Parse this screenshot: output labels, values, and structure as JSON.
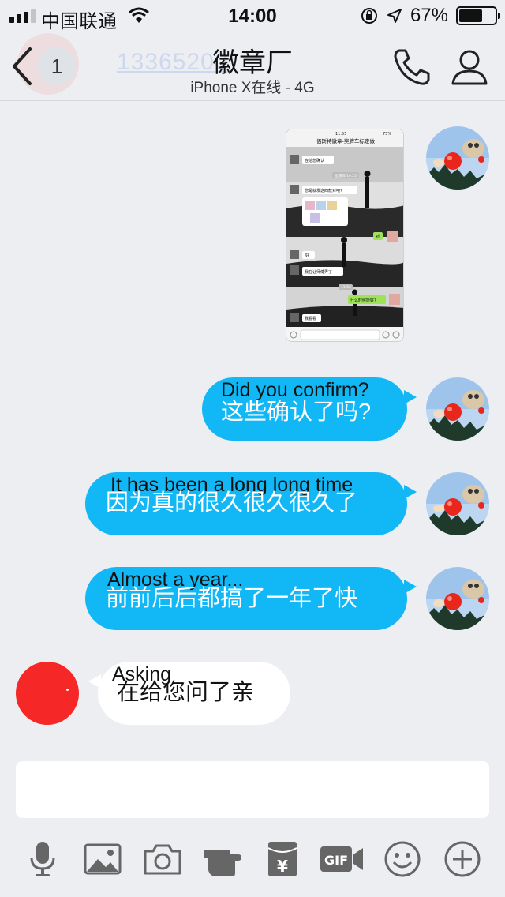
{
  "status_bar": {
    "carrier": "中国联通",
    "time": "14:00",
    "battery_text": "67%",
    "battery_level": 0.67
  },
  "nav": {
    "unread_count": "1",
    "ghost_number": "13365200",
    "title": "徽章厂",
    "subtitle": "iPhone X在线 - 4G"
  },
  "screenshot_message": {
    "title": "佰斯特徽章-奖牌车标定做",
    "status_time": "11:55",
    "status_batt": "75%",
    "lines": [
      "在给您确认",
      "星期四 16:25",
      "您是就发这四款对吧?",
      "对",
      "好",
      "我在让师傅弄了",
      "11:56",
      "什么时候能好?",
      "我看看"
    ]
  },
  "messages": [
    {
      "caption": "Did you confirm?",
      "text": "这些确认了吗?"
    },
    {
      "caption": "It has been a long long time",
      "text": "因为真的很久很久很久了"
    },
    {
      "caption": "Almost a year...",
      "text": "前前后后都搞了一年了快"
    },
    {
      "caption": "Asking",
      "text": "在给您问了亲"
    }
  ],
  "input": {
    "value": ""
  },
  "toolbar": {
    "gif_label": "GIF",
    "money_label": "¥"
  },
  "icons": [
    "signal-icon",
    "wifi-icon",
    "rotation-lock-icon",
    "location-arrow-icon",
    "battery-icon",
    "back-chevron-icon",
    "phone-icon",
    "profile-icon",
    "microphone-icon",
    "image-icon",
    "camera-icon",
    "poke-hand-icon",
    "red-packet-icon",
    "gif-icon",
    "emoji-icon",
    "plus-icon"
  ]
}
